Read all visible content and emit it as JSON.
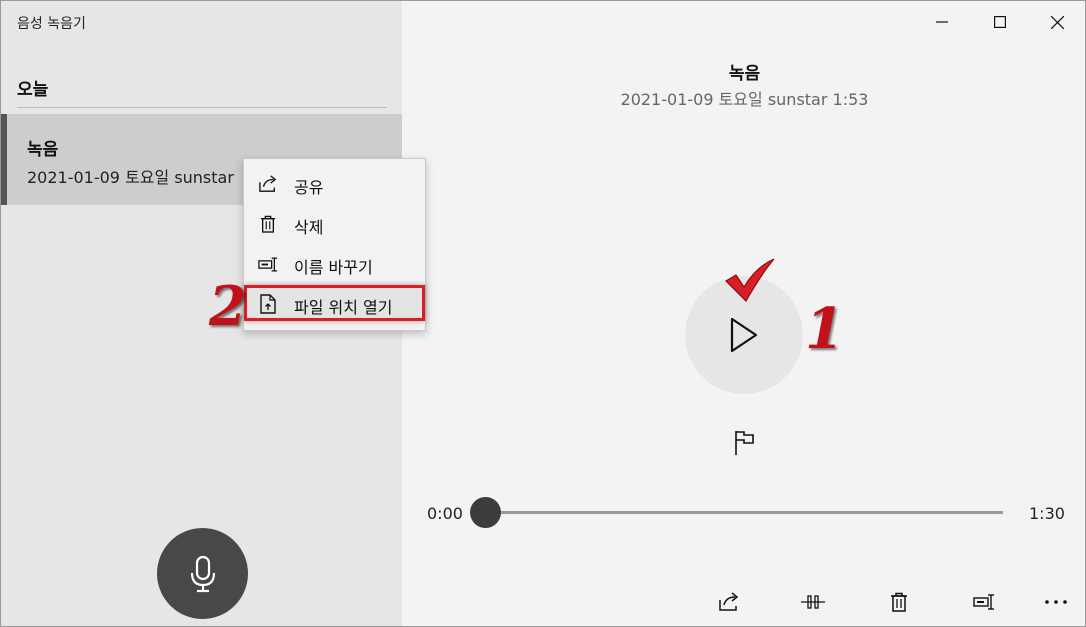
{
  "app": {
    "title": "음성 녹음기"
  },
  "sidebar": {
    "section_header": "오늘",
    "recordings": [
      {
        "name": "녹음",
        "meta": "2021-01-09 토요일 sunstar",
        "selected": true
      }
    ],
    "mic_button_icon": "microphone-icon"
  },
  "detail": {
    "title": "녹음",
    "meta": "2021-01-09 토요일 sunstar 1:53",
    "time_current": "0:00",
    "time_total": "1:30",
    "progress": 0.0
  },
  "context_menu": {
    "items": [
      {
        "label": "공유",
        "icon": "share-icon"
      },
      {
        "label": "삭제",
        "icon": "trash-icon"
      },
      {
        "label": "이름 바꾸기",
        "icon": "rename-icon"
      },
      {
        "label": "파일 위치 열기",
        "icon": "open-file-location-icon",
        "highlighted": true
      }
    ]
  },
  "annotations": {
    "step1": "1",
    "step2": "2"
  },
  "colors": {
    "annotation_red": "#c1121b",
    "sidebar_bg": "#e6e6e6",
    "selected_bg": "#cdcdcd",
    "main_bg": "#f3f3f3"
  },
  "toolbar_icons": [
    "share-icon",
    "trim-icon",
    "trash-icon",
    "rename-icon",
    "more-icon"
  ]
}
